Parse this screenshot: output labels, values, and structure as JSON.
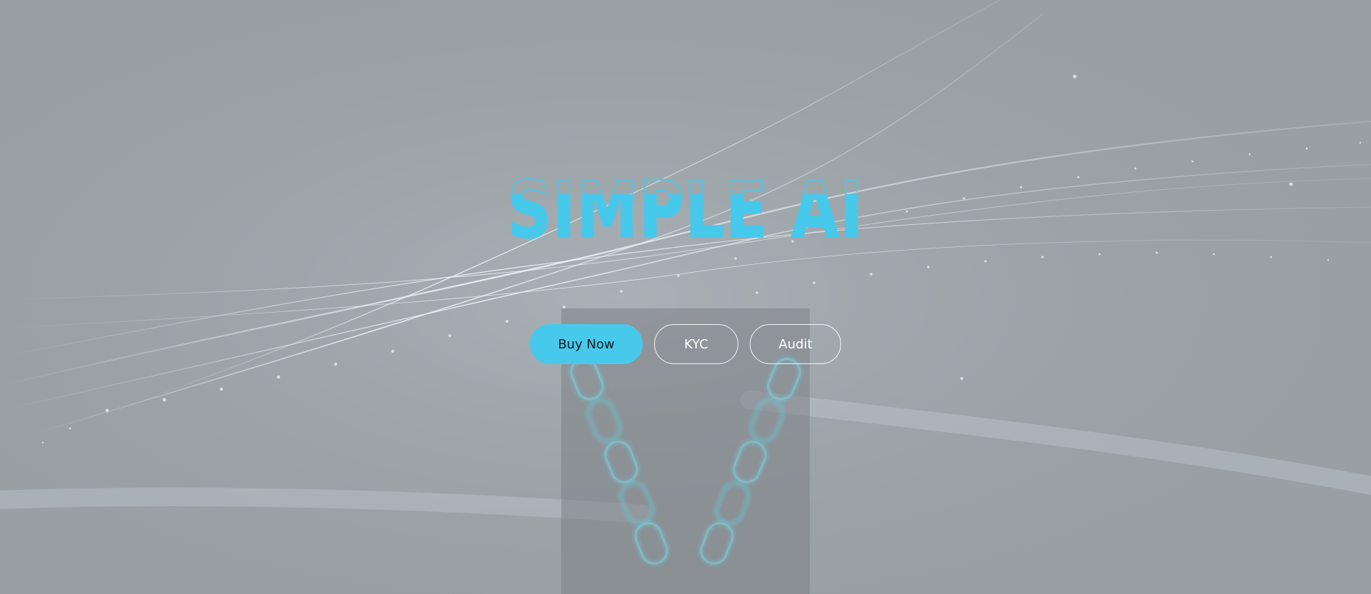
{
  "hero": {
    "title": "SIMPLE AI",
    "accent_color": "#47c9ec",
    "background_color": "#99a0a4"
  },
  "cta": {
    "buy_label": "Buy Now",
    "kyc_label": "KYC",
    "audit_label": "Audit"
  }
}
